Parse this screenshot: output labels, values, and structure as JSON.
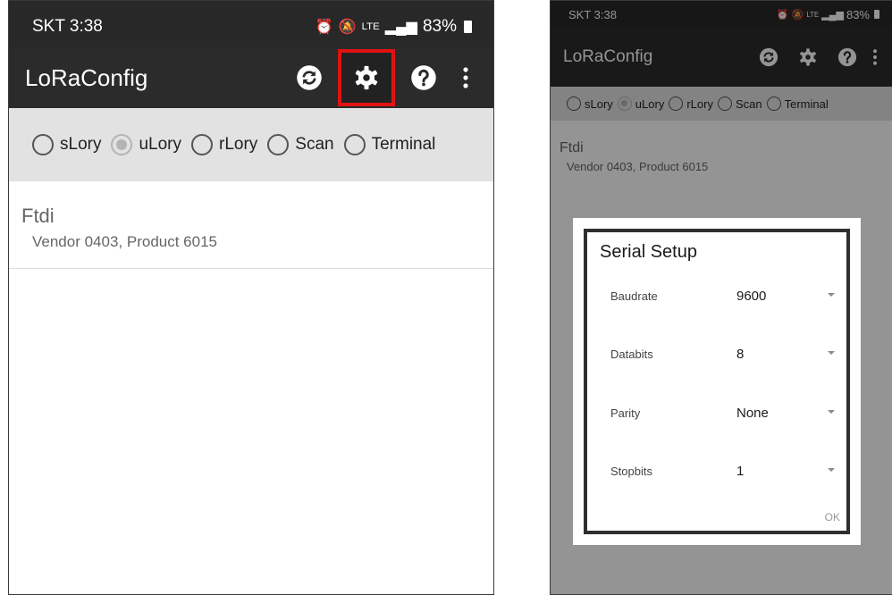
{
  "left_screen": {
    "status_bar": {
      "carrier_time": "SKT 3:38",
      "network": "LTE",
      "battery": "83%"
    },
    "app_bar": {
      "title": "LoRaConfig",
      "actions": [
        {
          "icon": "refresh-icon"
        },
        {
          "icon": "settings-gear-icon",
          "highlighted": true
        },
        {
          "icon": "help-icon"
        },
        {
          "icon": "overflow-menu-icon"
        }
      ],
      "highlight_color": "#e01212"
    },
    "radio_group": {
      "options": [
        {
          "label": "sLory",
          "checked": false
        },
        {
          "label": "uLory",
          "checked": true
        },
        {
          "label": "rLory",
          "checked": false
        },
        {
          "label": "Scan",
          "checked": false
        },
        {
          "label": "Terminal",
          "checked": false
        }
      ]
    },
    "device": {
      "name": "Ftdi",
      "detail": "Vendor 0403, Product 6015"
    }
  },
  "right_screen": {
    "status_bar": {
      "carrier_time": "SKT 3:38",
      "network": "LTE",
      "battery": "83%"
    },
    "app_bar": {
      "title": "LoRaConfig"
    },
    "radio_group": {
      "options": [
        {
          "label": "sLory",
          "checked": false
        },
        {
          "label": "uLory",
          "checked": true
        },
        {
          "label": "rLory",
          "checked": false
        },
        {
          "label": "Scan",
          "checked": false
        },
        {
          "label": "Terminal",
          "checked": false
        }
      ]
    },
    "device": {
      "name": "Ftdi",
      "detail": "Vendor 0403, Product 6015"
    },
    "dialog": {
      "title": "Serial Setup",
      "fields": [
        {
          "label": "Baudrate",
          "value": "9600"
        },
        {
          "label": "Databits",
          "value": "8"
        },
        {
          "label": "Parity",
          "value": "None"
        },
        {
          "label": "Stopbits",
          "value": "1"
        }
      ],
      "ok_label": "OK"
    }
  },
  "colors": {
    "status_bar": "#282828",
    "app_bar": "#2b2b2b",
    "radio_bar": "#e2e2e2",
    "highlight": "#e01212"
  }
}
